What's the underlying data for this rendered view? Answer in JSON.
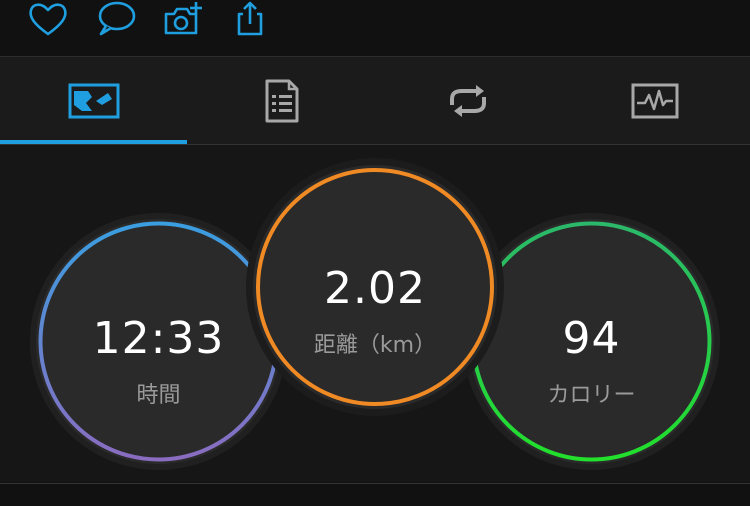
{
  "actions": [
    {
      "icon": "heart-icon"
    },
    {
      "icon": "comment-icon"
    },
    {
      "icon": "camera-add-icon"
    },
    {
      "icon": "share-icon"
    }
  ],
  "tabs": [
    {
      "icon": "activity-map-icon",
      "selected": true
    },
    {
      "icon": "details-list-icon",
      "selected": false
    },
    {
      "icon": "laps-icon",
      "selected": false
    },
    {
      "icon": "chart-icon",
      "selected": false
    }
  ],
  "stats": {
    "time": {
      "value": "12:33",
      "label": "時間"
    },
    "distance": {
      "value": "2.02",
      "label": "距離（km）"
    },
    "calories": {
      "value": "94",
      "label": "カロリー"
    }
  },
  "colors": {
    "accent": "#1f9fdf",
    "tab_icon_inactive": "#a8a8a8",
    "time_ring_top": "#3a9ee0",
    "time_ring_bottom": "#8a6cc0",
    "distance_ring": "#f08a24",
    "calories_ring_top": "#2bb86a",
    "calories_ring_bottom": "#22e02c"
  }
}
